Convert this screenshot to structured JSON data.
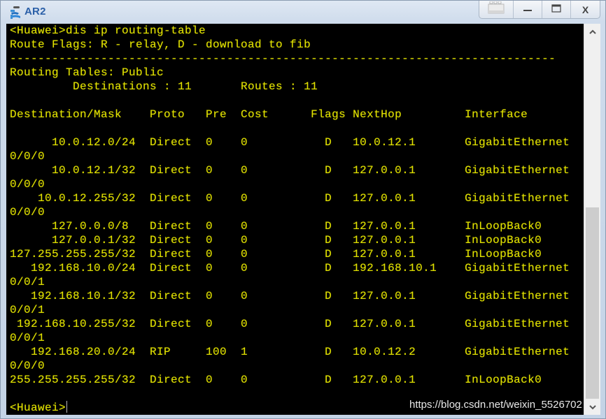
{
  "window": {
    "title": "AR2",
    "app_icon": "ensp-device-icon",
    "controls": {
      "layout_icon": "window-layout-icon",
      "minimize_label": "—",
      "maximize_icon": "maximize-icon",
      "close_label": "X"
    }
  },
  "terminal": {
    "lines": [
      "<Huawei>dis ip routing-table",
      "Route Flags: R - relay, D - download to fib",
      "------------------------------------------------------------------------------",
      "Routing Tables: Public",
      "         Destinations : 11       Routes : 11",
      "",
      "Destination/Mask    Proto   Pre  Cost      Flags NextHop         Interface",
      "",
      "      10.0.12.0/24  Direct  0    0           D   10.0.12.1       GigabitEthernet",
      "0/0/0",
      "      10.0.12.1/32  Direct  0    0           D   127.0.0.1       GigabitEthernet",
      "0/0/0",
      "    10.0.12.255/32  Direct  0    0           D   127.0.0.1       GigabitEthernet",
      "0/0/0",
      "      127.0.0.0/8   Direct  0    0           D   127.0.0.1       InLoopBack0",
      "      127.0.0.1/32  Direct  0    0           D   127.0.0.1       InLoopBack0",
      "127.255.255.255/32  Direct  0    0           D   127.0.0.1       InLoopBack0",
      "   192.168.10.0/24  Direct  0    0           D   192.168.10.1    GigabitEthernet",
      "0/0/1",
      "   192.168.10.1/32  Direct  0    0           D   127.0.0.1       GigabitEthernet",
      "0/0/1",
      " 192.168.10.255/32  Direct  0    0           D   127.0.0.1       GigabitEthernet",
      "0/0/1",
      "   192.168.20.0/24  RIP     100  1           D   10.0.12.2       GigabitEthernet",
      "0/0/0",
      "255.255.255.255/32  Direct  0    0           D   127.0.0.1       InLoopBack0",
      "",
      "<Huawei>"
    ],
    "prompt": "<Huawei>",
    "command": "dis ip routing-table",
    "summary": {
      "table": "Public",
      "destinations": 11,
      "routes": 11
    },
    "routes": [
      {
        "destination": "10.0.12.0/24",
        "proto": "Direct",
        "pre": "0",
        "cost": "0",
        "flags": "D",
        "nexthop": "10.0.12.1",
        "interface": "GigabitEthernet0/0/0"
      },
      {
        "destination": "10.0.12.1/32",
        "proto": "Direct",
        "pre": "0",
        "cost": "0",
        "flags": "D",
        "nexthop": "127.0.0.1",
        "interface": "GigabitEthernet0/0/0"
      },
      {
        "destination": "10.0.12.255/32",
        "proto": "Direct",
        "pre": "0",
        "cost": "0",
        "flags": "D",
        "nexthop": "127.0.0.1",
        "interface": "GigabitEthernet0/0/0"
      },
      {
        "destination": "127.0.0.0/8",
        "proto": "Direct",
        "pre": "0",
        "cost": "0",
        "flags": "D",
        "nexthop": "127.0.0.1",
        "interface": "InLoopBack0"
      },
      {
        "destination": "127.0.0.1/32",
        "proto": "Direct",
        "pre": "0",
        "cost": "0",
        "flags": "D",
        "nexthop": "127.0.0.1",
        "interface": "InLoopBack0"
      },
      {
        "destination": "127.255.255.255/32",
        "proto": "Direct",
        "pre": "0",
        "cost": "0",
        "flags": "D",
        "nexthop": "127.0.0.1",
        "interface": "InLoopBack0"
      },
      {
        "destination": "192.168.10.0/24",
        "proto": "Direct",
        "pre": "0",
        "cost": "0",
        "flags": "D",
        "nexthop": "192.168.10.1",
        "interface": "GigabitEthernet0/0/1"
      },
      {
        "destination": "192.168.10.1/32",
        "proto": "Direct",
        "pre": "0",
        "cost": "0",
        "flags": "D",
        "nexthop": "127.0.0.1",
        "interface": "GigabitEthernet0/0/1"
      },
      {
        "destination": "192.168.10.255/32",
        "proto": "Direct",
        "pre": "0",
        "cost": "0",
        "flags": "D",
        "nexthop": "127.0.0.1",
        "interface": "GigabitEthernet0/0/1"
      },
      {
        "destination": "192.168.20.0/24",
        "proto": "RIP",
        "pre": "100",
        "cost": "1",
        "flags": "D",
        "nexthop": "10.0.12.2",
        "interface": "GigabitEthernet0/0/0"
      },
      {
        "destination": "255.255.255.255/32",
        "proto": "Direct",
        "pre": "0",
        "cost": "0",
        "flags": "D",
        "nexthop": "127.0.0.1",
        "interface": "InLoopBack0"
      }
    ],
    "text_color": "#e1e100",
    "background_color": "#000000"
  },
  "scrollbar": {
    "up_arrow": "^",
    "down_arrow": "v",
    "position_fraction": 1.0
  },
  "watermark": "https://blog.csdn.net/weixin_5526702"
}
